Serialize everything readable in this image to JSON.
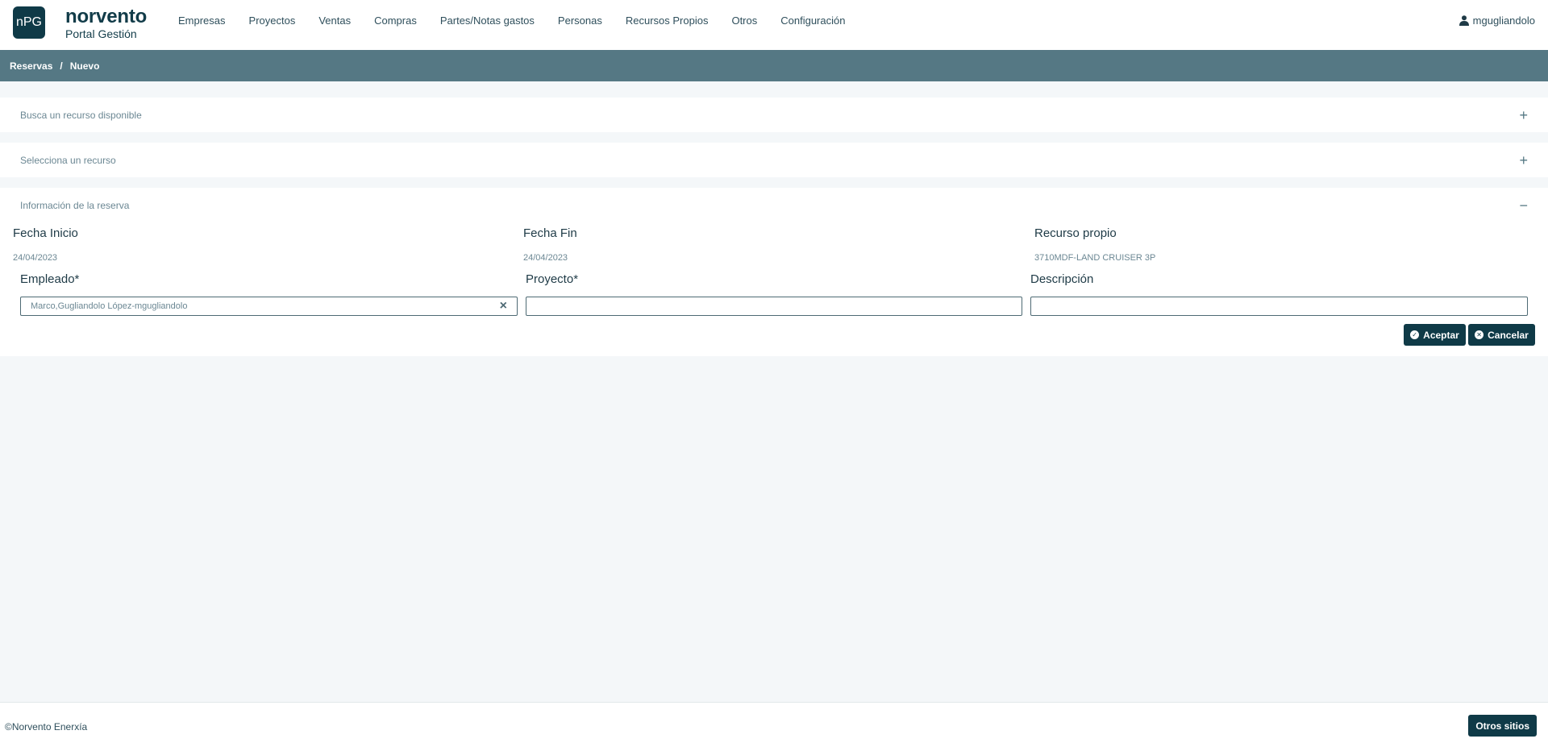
{
  "header": {
    "logo_text": "nPG",
    "brand_name": "norvento",
    "brand_sub": "Portal Gestión",
    "nav": [
      "Empresas",
      "Proyectos",
      "Ventas",
      "Compras",
      "Partes/Notas gastos",
      "Personas",
      "Recursos Propios",
      "Otros",
      "Configuración"
    ],
    "user": "mgugliandolo"
  },
  "breadcrumb": {
    "first": "Reservas",
    "separator": "/",
    "second": "Nuevo"
  },
  "panels": {
    "search": {
      "title": "Busca un recurso disponible",
      "toggle": "+"
    },
    "select": {
      "title": "Selecciona un recurso",
      "toggle": "+"
    },
    "info": {
      "title": "Información de la reserva",
      "toggle": "−"
    }
  },
  "form": {
    "fecha_inicio_label": "Fecha Inicio",
    "fecha_inicio_value": "24/04/2023",
    "fecha_fin_label": "Fecha Fin",
    "fecha_fin_value": "24/04/2023",
    "recurso_label": "Recurso propio",
    "recurso_value": "3710MDF-LAND CRUISER 3P",
    "empleado_label": "Empleado*",
    "empleado_value": "Marco,Gugliandolo López-mgugliandolo",
    "proyecto_label": "Proyecto*",
    "proyecto_value": "",
    "descripcion_label": "Descripción",
    "descripcion_value": "",
    "aceptar": "Aceptar",
    "cancelar": "Cancelar"
  },
  "footer": {
    "copyright": "©Norvento Enerxía",
    "otros_sitios": "Otros sitios"
  },
  "colors": {
    "primary": "#0f3a47",
    "breadcrumb": "#557884",
    "background": "#f4f7f9"
  },
  "icons": {
    "user": "user-icon",
    "clear": "close-icon",
    "accept": "check-circle-icon",
    "cancel": "x-circle-icon"
  }
}
